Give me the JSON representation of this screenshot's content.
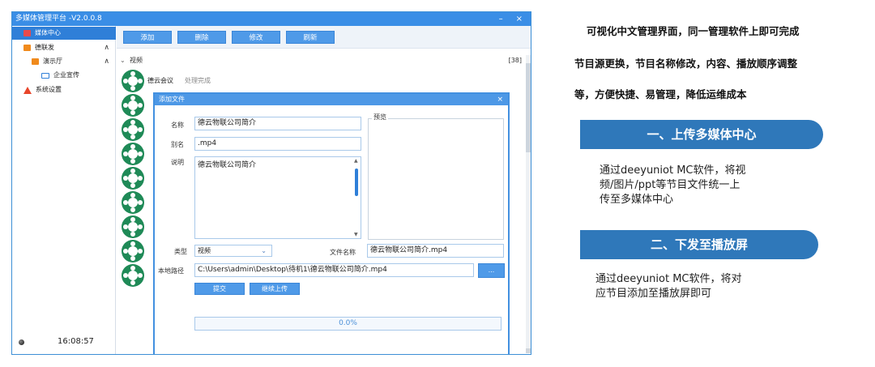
{
  "window": {
    "title": "多媒体管理平台 -V2.0.0.8",
    "minimize": "–",
    "close": "×"
  },
  "sidebar": {
    "items": [
      {
        "label": "媒体中心",
        "icon": "media-icon"
      },
      {
        "label": "德联发",
        "icon": "folder-icon",
        "caret": "∧"
      },
      {
        "label": "演示厅",
        "icon": "folder-icon",
        "caret": "∧"
      },
      {
        "label": "企业宣传",
        "icon": "screen-icon"
      },
      {
        "label": "系统设置",
        "icon": "warning-icon"
      }
    ],
    "clock": "16:08:57"
  },
  "toolbar": {
    "add": "添加",
    "delete": "删除",
    "edit": "修改",
    "refresh": "刷新"
  },
  "list": {
    "section": "视频",
    "count": "[38]",
    "items": [
      {
        "name": "德云会议",
        "status": "处理完成"
      },
      {
        "name": "",
        "status": ""
      },
      {
        "name": "",
        "status": ""
      },
      {
        "name": "",
        "status": ""
      },
      {
        "name": "",
        "status": ""
      },
      {
        "name": "",
        "status": ""
      },
      {
        "name": "",
        "status": ""
      },
      {
        "name": "",
        "status": ""
      },
      {
        "name": "",
        "status": ""
      }
    ]
  },
  "dialog": {
    "title": "添加文件",
    "close": "×",
    "name_label": "名称",
    "name_value": "德云物联公司简介",
    "alias_label": "别名",
    "alias_value": ".mp4",
    "desc_label": "说明",
    "desc_value": "德云物联公司简介",
    "preview_label": "预览",
    "type_label": "类型",
    "type_value": "视频",
    "filename_label": "文件名称",
    "filename_value": "德云物联公司简介.mp4",
    "path_label": "本地路径",
    "path_value": "C:\\Users\\admin\\Desktop\\待机1\\德云物联公司简介.mp4",
    "browse": "...",
    "submit": "提交",
    "continue": "继续上传",
    "progress": 0,
    "progress_text": "0.0%"
  },
  "info": {
    "intro": [
      "可视化中文管理界面，同一管理软件上即可完成",
      "节目源更换，节目名称修改，内容、播放顺序调整",
      "等，方便快捷、易管理，降低运维成本"
    ],
    "sections": [
      {
        "title": "一、上传多媒体中心",
        "lines": [
          "通过deeyuniot MC软件，将视",
          "频/图片/ppt等节目文件统一上",
          "传至多媒体中心"
        ]
      },
      {
        "title": "二、下发至播放屏",
        "lines": [
          "通过deeyuniot MC软件，将对",
          "应节目添加至播放屏即可"
        ]
      }
    ],
    "accent": "#2f78ba"
  }
}
